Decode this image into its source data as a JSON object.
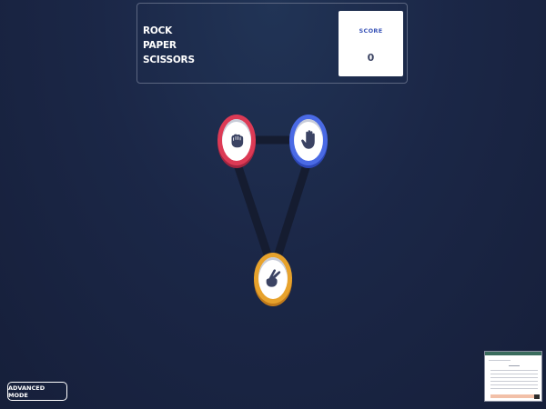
{
  "title": {
    "line1": "ROCK",
    "line2": "PAPER",
    "line3": "SCISSORS"
  },
  "score": {
    "label": "SCORE",
    "value": "0"
  },
  "choices": [
    {
      "name": "rock",
      "icon": "rock-fist-icon",
      "color": "#dc3a55"
    },
    {
      "name": "paper",
      "icon": "paper-hand-icon",
      "color": "#4a6ae5"
    },
    {
      "name": "scissors",
      "icon": "scissors-hand-icon",
      "color": "#e7a22c"
    }
  ],
  "buttons": {
    "advanced_mode": "ADVANCED MODE"
  },
  "colors": {
    "background": "#1b2747",
    "accent_score": "#3b55b8"
  }
}
